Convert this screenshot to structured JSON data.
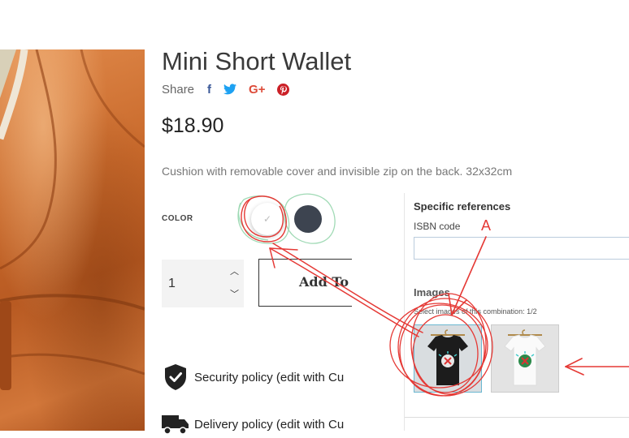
{
  "product": {
    "title": "Mini Short Wallet",
    "share_label": "Share",
    "share_icons": [
      "facebook-icon",
      "twitter-icon",
      "google-plus-icon",
      "pinterest-icon"
    ],
    "share_glyphs": {
      "facebook": "f",
      "google_plus": "G+"
    },
    "price": "$18.90",
    "description": "Cushion with removable cover and invisible zip on the back. 32x32cm",
    "color_label": "COLOR",
    "colors": [
      {
        "name": "white",
        "hex": "#ffffff",
        "selected": true
      },
      {
        "name": "dark-grey",
        "hex": "#3d4450",
        "selected": false
      }
    ],
    "quantity": "1",
    "add_to_cart_label": "Add To C"
  },
  "policies": [
    {
      "label": "Security policy (edit with Cu",
      "icon": "shield-check-icon"
    },
    {
      "label": "Delivery policy (edit with Cu",
      "icon": "truck-icon"
    }
  ],
  "admin": {
    "heading": "Specific references",
    "isbn_label": "ISBN code",
    "isbn_value": "",
    "images_label": "Images",
    "images_hint": "Select images of this combination: 1/2",
    "thumbnails": [
      {
        "name": "black-tshirt",
        "selected": true
      },
      {
        "name": "white-tshirt",
        "selected": false
      }
    ]
  },
  "annotation": {
    "letter": "A",
    "color": "#e53935"
  },
  "colors": {
    "facebook": "#3b5998",
    "twitter": "#1da1f2",
    "google_plus": "#dd4b39",
    "pinterest": "#cb2027",
    "leather": "#c96a2c"
  }
}
